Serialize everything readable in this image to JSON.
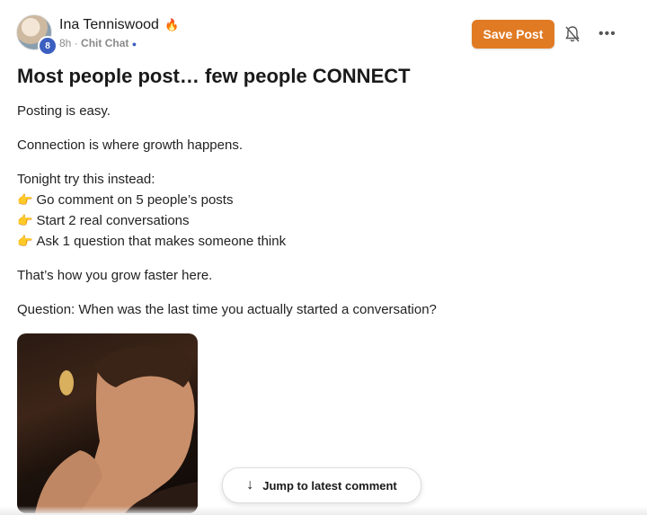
{
  "post": {
    "author": "Ina Tenniswood",
    "author_badge_icon": "fire-icon",
    "level": "8",
    "time": "8h",
    "separator": "·",
    "category": "Chit Chat",
    "title": "Most people post… few people CONNECT",
    "paragraphs": {
      "p1": "Posting is easy.",
      "p2": "Connection is where growth happens.",
      "p3": "Tonight try this instead:",
      "tips": [
        "Go comment on 5 people’s posts",
        "Start 2 real conversations",
        "Ask 1 question that makes someone think"
      ],
      "p4": "That’s how you grow faster here.",
      "p5": "Question: When was the last time you actually started a conversation?"
    }
  },
  "actions": {
    "save_label": "Save Post",
    "jump_label": "Jump to latest comment"
  },
  "colors": {
    "accent": "#e07b24",
    "level_badge": "#3b5fc0"
  }
}
